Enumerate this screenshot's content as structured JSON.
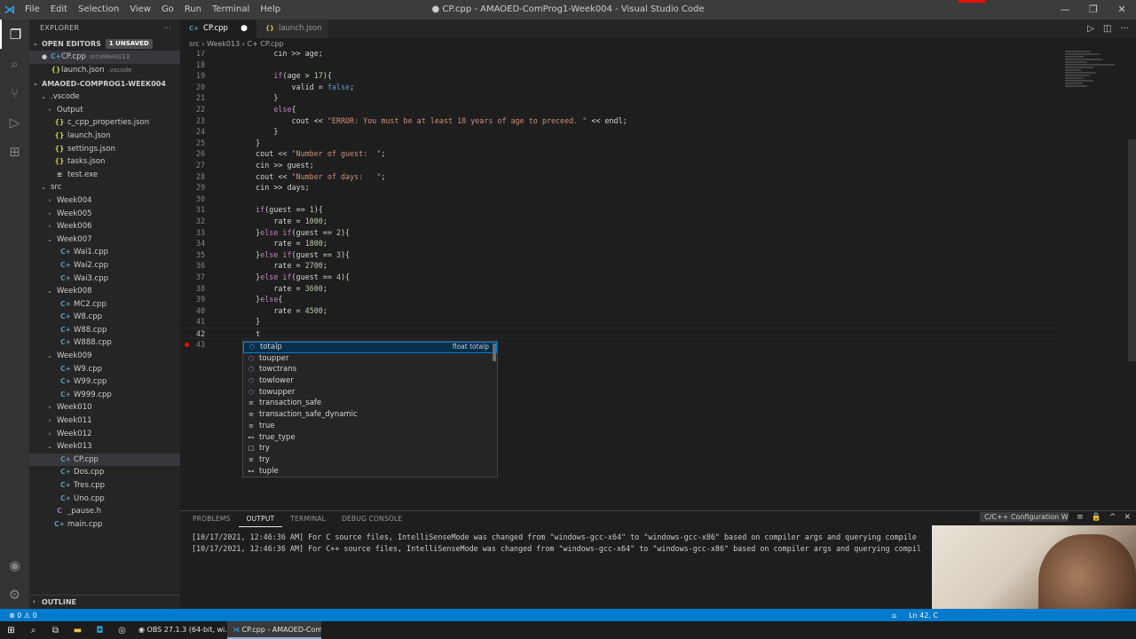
{
  "titlebar": {
    "menu": [
      "File",
      "Edit",
      "Selection",
      "View",
      "Go",
      "Run",
      "Terminal",
      "Help"
    ],
    "title": "● CP.cpp - AMAOED-ComProg1-Week004 - Visual Studio Code",
    "minimize": "—",
    "restore": "❐",
    "close": "✕"
  },
  "sidebar": {
    "title": "EXPLORER",
    "more": "···",
    "open_editors_label": "OPEN EDITORS",
    "unsaved_badge": "1 UNSAVED",
    "open_editors": [
      {
        "dirty": "●",
        "name": "CP.cpp",
        "path": "src\\Week013"
      },
      {
        "icon": "{}",
        "name": "launch.json",
        "path": ".vscode"
      }
    ],
    "workspace_label": "AMAOED-COMPROG1-WEEK004",
    "tree": [
      {
        "indent": 1,
        "chev": "⌄",
        "name": ".vscode"
      },
      {
        "indent": 2,
        "chev": "›",
        "name": "Output"
      },
      {
        "indent": 2,
        "icon": "{}",
        "type": "json",
        "name": "c_cpp_properties.json"
      },
      {
        "indent": 2,
        "icon": "{}",
        "type": "json",
        "name": "launch.json"
      },
      {
        "indent": 2,
        "icon": "{}",
        "type": "json",
        "name": "settings.json"
      },
      {
        "indent": 2,
        "icon": "{}",
        "type": "json",
        "name": "tasks.json"
      },
      {
        "indent": 2,
        "icon": "≡",
        "type": "exe",
        "name": "test.exe"
      },
      {
        "indent": 1,
        "chev": "⌄",
        "name": "src"
      },
      {
        "indent": 2,
        "chev": "›",
        "name": "Week004"
      },
      {
        "indent": 2,
        "chev": "›",
        "name": "Week005"
      },
      {
        "indent": 2,
        "chev": "›",
        "name": "Week006"
      },
      {
        "indent": 2,
        "chev": "⌄",
        "name": "Week007"
      },
      {
        "indent": 3,
        "icon": "C+",
        "type": "cpp",
        "name": "Wai1.cpp"
      },
      {
        "indent": 3,
        "icon": "C+",
        "type": "cpp",
        "name": "Wai2.cpp"
      },
      {
        "indent": 3,
        "icon": "C+",
        "type": "cpp",
        "name": "Wai3.cpp"
      },
      {
        "indent": 2,
        "chev": "⌄",
        "name": "Week008"
      },
      {
        "indent": 3,
        "icon": "C+",
        "type": "cpp",
        "name": "MC2.cpp"
      },
      {
        "indent": 3,
        "icon": "C+",
        "type": "cpp",
        "name": "W8.cpp"
      },
      {
        "indent": 3,
        "icon": "C+",
        "type": "cpp",
        "name": "W88.cpp"
      },
      {
        "indent": 3,
        "icon": "C+",
        "type": "cpp",
        "name": "W888.cpp"
      },
      {
        "indent": 2,
        "chev": "⌄",
        "name": "Week009"
      },
      {
        "indent": 3,
        "icon": "C+",
        "type": "cpp",
        "name": "W9.cpp"
      },
      {
        "indent": 3,
        "icon": "C+",
        "type": "cpp",
        "name": "W99.cpp"
      },
      {
        "indent": 3,
        "icon": "C+",
        "type": "cpp",
        "name": "W999.cpp"
      },
      {
        "indent": 2,
        "chev": "›",
        "name": "Week010"
      },
      {
        "indent": 2,
        "chev": "›",
        "name": "Week011"
      },
      {
        "indent": 2,
        "chev": "›",
        "name": "Week012"
      },
      {
        "indent": 2,
        "chev": "⌄",
        "name": "Week013"
      },
      {
        "indent": 3,
        "icon": "C+",
        "type": "cpp",
        "name": "CP.cpp",
        "selected": true
      },
      {
        "indent": 3,
        "icon": "C+",
        "type": "cpp",
        "name": "Dos.cpp"
      },
      {
        "indent": 3,
        "icon": "C+",
        "type": "cpp",
        "name": "Tres.cpp"
      },
      {
        "indent": 3,
        "icon": "C+",
        "type": "cpp",
        "name": "Uno.cpp"
      },
      {
        "indent": 2,
        "icon": "C",
        "type": "h",
        "name": "_pause.h"
      },
      {
        "indent": 2,
        "icon": "C+",
        "type": "cpp",
        "name": "main.cpp"
      }
    ],
    "outline_label": "OUTLINE"
  },
  "tabs": [
    {
      "icon": "C+",
      "label": "CP.cpp",
      "dirty": "●",
      "active": true
    },
    {
      "icon": "{}",
      "label": "launch.json",
      "active": false
    }
  ],
  "breadcrumb": "src › Week013 › C+ CP.cpp",
  "code": [
    {
      "n": "17",
      "html": "        cin >> age;"
    },
    {
      "n": "18",
      "html": ""
    },
    {
      "n": "19",
      "html": "        <span class=\"k\">if</span>(age > <span class=\"n\">17</span>){"
    },
    {
      "n": "20",
      "html": "            valid = <span class=\"b\">false</span>;"
    },
    {
      "n": "21",
      "html": "        }"
    },
    {
      "n": "22",
      "html": "        <span class=\"k\">else</span>{"
    },
    {
      "n": "23",
      "html": "            cout << <span class=\"s\">\"ERROR: You must be at least 18 years of age to preceed. \"</span> << endl;"
    },
    {
      "n": "24",
      "html": "        }"
    },
    {
      "n": "25",
      "html": "    }"
    },
    {
      "n": "26",
      "html": "    cout << <span class=\"s\">\"Number of guest:  \"</span>;"
    },
    {
      "n": "27",
      "html": "    cin >> guest;"
    },
    {
      "n": "28",
      "html": "    cout << <span class=\"s\">\"Number of days:   \"</span>;"
    },
    {
      "n": "29",
      "html": "    cin >> days;"
    },
    {
      "n": "30",
      "html": ""
    },
    {
      "n": "31",
      "html": "    <span class=\"k\">if</span>(guest == <span class=\"n\">1</span>){"
    },
    {
      "n": "32",
      "html": "        rate = <span class=\"n\">1000</span>;"
    },
    {
      "n": "33",
      "html": "    }<span class=\"k\">else if</span>(guest == <span class=\"n\">2</span>){"
    },
    {
      "n": "34",
      "html": "        rate = <span class=\"n\">1800</span>;"
    },
    {
      "n": "35",
      "html": "    }<span class=\"k\">else if</span>(guest == <span class=\"n\">3</span>){"
    },
    {
      "n": "36",
      "html": "        rate = <span class=\"n\">2700</span>;"
    },
    {
      "n": "37",
      "html": "    }<span class=\"k\">else if</span>(guest == <span class=\"n\">4</span>){"
    },
    {
      "n": "38",
      "html": "        rate = <span class=\"n\">3600</span>;"
    },
    {
      "n": "39",
      "html": "    }<span class=\"k\">else</span>{"
    },
    {
      "n": "40",
      "html": "        rate = <span class=\"n\">4500</span>;"
    },
    {
      "n": "41",
      "html": "    }"
    },
    {
      "n": "42",
      "html": "    t",
      "current": true
    },
    {
      "n": "43",
      "html": "",
      "breakpoint": true
    }
  ],
  "suggestions": [
    {
      "icon": "⬡",
      "kind": "var",
      "label": "totalp",
      "detail": "float totalp",
      "selected": true
    },
    {
      "icon": "⬡",
      "kind": "fn",
      "label": "toupper"
    },
    {
      "icon": "⬡",
      "kind": "fn",
      "label": "towctrans"
    },
    {
      "icon": "⬡",
      "kind": "fn",
      "label": "towlower"
    },
    {
      "icon": "⬡",
      "kind": "fn",
      "label": "towupper"
    },
    {
      "icon": "≡",
      "kind": "kw",
      "label": "transaction_safe"
    },
    {
      "icon": "≡",
      "kind": "kw",
      "label": "transaction_safe_dynamic"
    },
    {
      "icon": "≡",
      "kind": "kw",
      "label": "true"
    },
    {
      "icon": "⊷",
      "kind": "kw",
      "label": "true_type"
    },
    {
      "icon": "□",
      "kind": "kw",
      "label": "try"
    },
    {
      "icon": "≡",
      "kind": "kw",
      "label": "try"
    },
    {
      "icon": "⊷",
      "kind": "kw",
      "label": "tuple"
    }
  ],
  "panel": {
    "tabs": [
      "PROBLEMS",
      "OUTPUT",
      "TERMINAL",
      "DEBUG CONSOLE"
    ],
    "active_tab": "OUTPUT",
    "channel": "C/C++ Configuration W",
    "output": [
      "[10/17/2021, 12:46:36 AM] For C source files, IntelliSenseMode was changed from \"windows-gcc-x64\" to \"windows-gcc-x86\" based on compiler args and querying compile",
      "[10/17/2021, 12:46:36 AM] For C++ source files, IntelliSenseMode was changed from \"windows-gcc-x64\" to \"windows-gcc-x86\" based on compiler args and querying compil"
    ]
  },
  "statusbar": {
    "problems": "⊗ 0 ⚠ 0",
    "bell": "🔔",
    "position": "Ln 42, C"
  },
  "taskbar": {
    "apps": [
      {
        "label": "OBS 27.1.3 (64-bit, wi...",
        "active": false
      },
      {
        "label": "CP.cpp - AMAOED-Com...",
        "active": true
      }
    ]
  }
}
